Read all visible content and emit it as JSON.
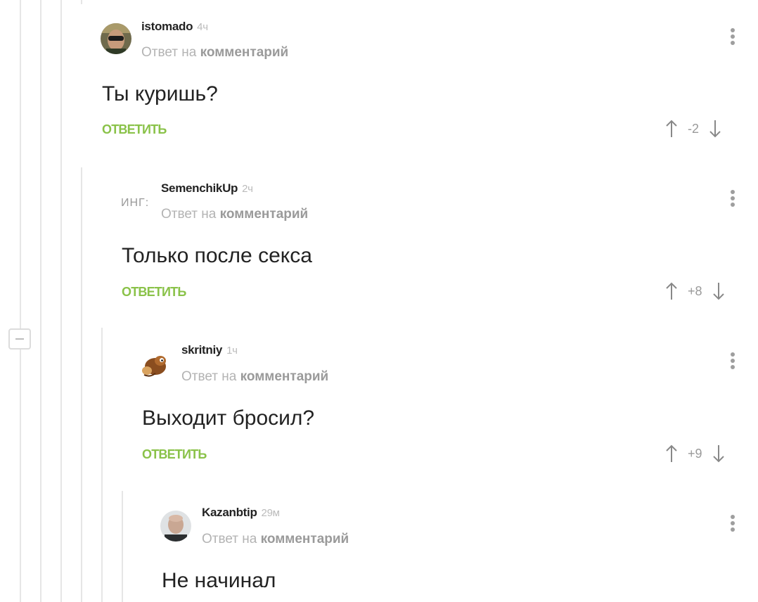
{
  "comments": [
    {
      "username": "istomado",
      "time": "4ч",
      "reply_prefix": "Ответ на",
      "reply_link": "комментарий",
      "text": "Ты куришь?",
      "reply_label": "ОТВЕТИТЬ",
      "score": "-2",
      "avatar": "avatar-man-with-sunglasses"
    },
    {
      "username": "SemenchikUp",
      "time": "2ч",
      "reply_prefix": "Ответ на",
      "reply_link": "комментарий",
      "text": "Только после секса",
      "reply_label": "ОТВЕТИТЬ",
      "score": "+8",
      "avatar_text": "ИНГ:"
    },
    {
      "username": "skritniy",
      "time": "1ч",
      "reply_prefix": "Ответ на",
      "reply_link": "комментарий",
      "text": "Выходит бросил?",
      "reply_label": "ОТВЕТИТЬ",
      "score": "+9",
      "avatar": "avatar-cartoon-chipmunk"
    },
    {
      "username": "Kazanbtip",
      "time": "29м",
      "reply_prefix": "Ответ на",
      "reply_link": "комментарий",
      "text": "Не начинал",
      "avatar": "avatar-bald-man"
    }
  ],
  "icons": [
    "more-vertical-icon",
    "arrow-up-icon",
    "arrow-down-icon",
    "collapse-minus-icon"
  ],
  "colors": {
    "reply_green": "#8ac249",
    "meta_gray": "#b3b3b3",
    "thread_line": "#e6e6e6"
  }
}
